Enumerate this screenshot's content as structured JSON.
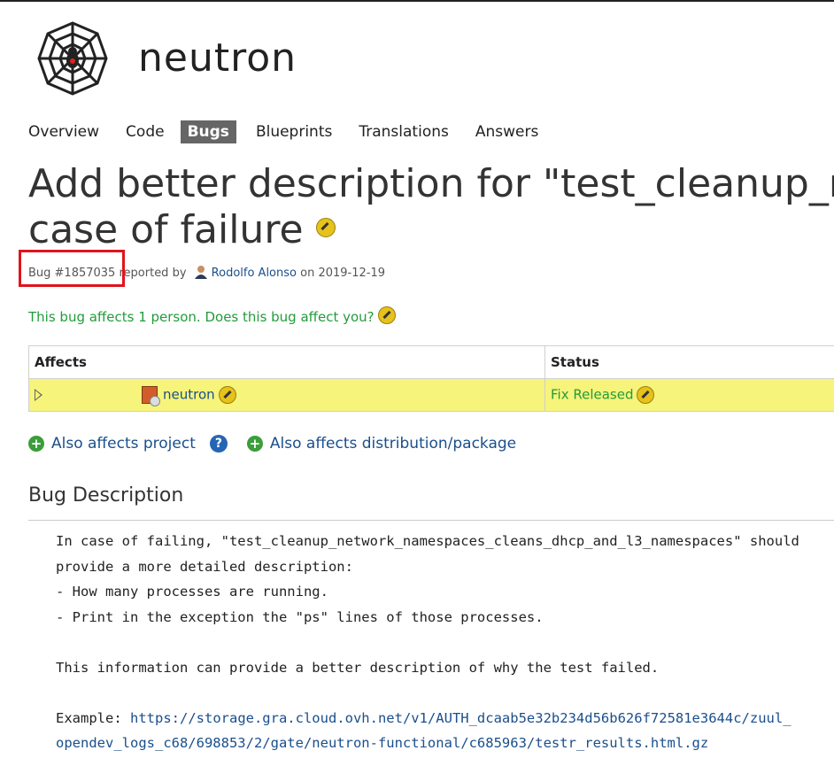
{
  "project": {
    "name": "neutron"
  },
  "nav": {
    "tabs": [
      {
        "label": "Overview",
        "active": false
      },
      {
        "label": "Code",
        "active": false
      },
      {
        "label": "Bugs",
        "active": true
      },
      {
        "label": "Blueprints",
        "active": false
      },
      {
        "label": "Translations",
        "active": false
      },
      {
        "label": "Answers",
        "active": false
      }
    ]
  },
  "bug": {
    "title_line1": "Add better description for \"test_cleanup_n",
    "title_line2": "case of failure",
    "id_label": "Bug #1857035",
    "reported_by_label": "reported by",
    "reporter": "Rodolfo Alonso",
    "on_label": "on",
    "date": "2019-12-19",
    "affects_text": "This bug affects 1 person. Does this bug affect you?"
  },
  "affects_table": {
    "headers": [
      "Affects",
      "Status"
    ],
    "rows": [
      {
        "project": "neutron",
        "status": "Fix Released"
      }
    ]
  },
  "also_affects": {
    "project_label": "Also affects project",
    "help_glyph": "?",
    "distribution_label": "Also affects distribution/package"
  },
  "description": {
    "heading": "Bug Description",
    "line1": "In case of failing, \"test_cleanup_network_namespaces_cleans_dhcp_and_l3_namespaces\" should",
    "line2": "provide a more detailed description:",
    "line3": "- How many processes are running.",
    "line4": "- Print in the exception the \"ps\" lines of those processes.",
    "line5": "",
    "line6": "This information can provide a better description of why the test failed.",
    "line7": "",
    "example_label": "Example: ",
    "link_part1": "https://storage.gra.cloud.ovh.net/v1/AUTH_dcaab5e32b234d56b626f72581e3644c/zuul_",
    "link_part2": "opendev_logs_c68/698853/2/gate/neutron-functional/c685963/testr_results.html.gz"
  },
  "colors": {
    "status_green": "#219c3a",
    "link_blue": "#1a4f8c",
    "row_highlight": "#f6f47a",
    "annotation_red": "#e0141b"
  }
}
